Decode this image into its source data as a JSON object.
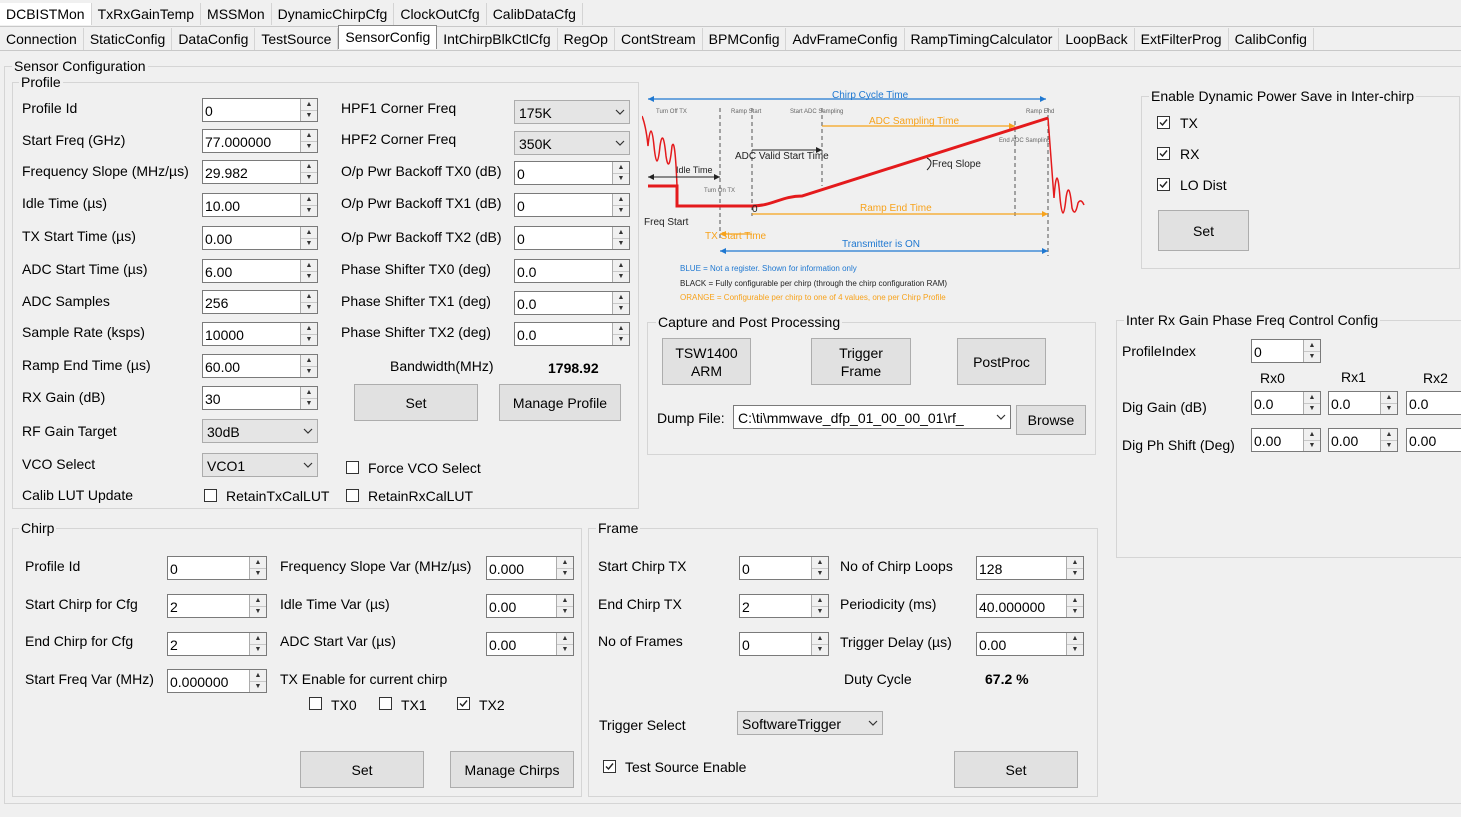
{
  "tabs_top": [
    "DCBISTMon",
    "TxRxGainTemp",
    "MSSMon",
    "DynamicChirpCfg",
    "ClockOutCfg",
    "CalibDataCfg"
  ],
  "tabs_second": [
    "Connection",
    "StaticConfig",
    "DataConfig",
    "TestSource",
    "SensorConfig",
    "IntChirpBlkCtlCfg",
    "RegOp",
    "ContStream",
    "BPMConfig",
    "AdvFrameConfig",
    "RampTimingCalculator",
    "LoopBack",
    "ExtFilterProg",
    "CalibConfig"
  ],
  "sensor_title": "Sensor Configuration",
  "profile": {
    "title": "Profile",
    "labels": {
      "profile_id": "Profile Id",
      "start_freq": "Start Freq (GHz)",
      "freq_slope": "Frequency Slope (MHz/µs)",
      "idle_time": "Idle Time (µs)",
      "tx_start": "TX Start Time (µs)",
      "adc_start": "ADC Start Time (µs)",
      "adc_samples": "ADC Samples",
      "sample_rate": "Sample Rate (ksps)",
      "ramp_end": "Ramp End Time (µs)",
      "rx_gain": "RX Gain (dB)",
      "rf_gain": "RF Gain Target",
      "vco": "VCO Select",
      "calib": "Calib LUT Update",
      "hpf1": "HPF1 Corner Freq",
      "hpf2": "HPF2 Corner Freq",
      "bo0": "O/p Pwr Backoff TX0 (dB)",
      "bo1": "O/p Pwr Backoff TX1 (dB)",
      "bo2": "O/p Pwr Backoff TX2 (dB)",
      "ps0": "Phase Shifter TX0 (deg)",
      "ps1": "Phase Shifter TX1 (deg)",
      "ps2": "Phase Shifter TX2 (deg)",
      "bandwidth": "Bandwidth(MHz)",
      "force_vco": "Force VCO Select",
      "retain_tx": "RetainTxCalLUT",
      "retain_rx": "RetainRxCalLUT"
    },
    "values": {
      "profile_id": "0",
      "start_freq": "77.000000",
      "freq_slope": "29.982",
      "idle_time": "10.00",
      "tx_start": "0.00",
      "adc_start": "6.00",
      "adc_samples": "256",
      "sample_rate": "10000",
      "ramp_end": "60.00",
      "rx_gain": "30",
      "rf_gain": "30dB",
      "vco": "VCO1",
      "hpf1": "175K",
      "hpf2": "350K",
      "bo0": "0",
      "bo1": "0",
      "bo2": "0",
      "ps0": "0.0",
      "ps1": "0.0",
      "ps2": "0.0",
      "bandwidth": "1798.92",
      "force_vco": false,
      "retain_tx": false,
      "retain_rx": false
    },
    "set_label": "Set",
    "manage_label": "Manage Profile"
  },
  "diagram": {
    "chirp_cycle": "Chirp Cycle Time",
    "turn_off_tx": "Turn Off TX",
    "ramp_start": "Ramp Start",
    "start_adc": "Start ADC Sampling",
    "adc_sampling_time": "ADC Sampling Time",
    "ramp_end": "Ramp End",
    "end_adc": "End ADC Sampling",
    "adc_valid": "ADC Valid Start Time",
    "idle_time": "Idle Time",
    "freq_slope": "Freq Slope",
    "turn_on_tx": "Turn On TX",
    "zero": "0",
    "ramp_end_time": "Ramp End Time",
    "freq_start": "Freq Start",
    "tx_start_time": "TX Start Time",
    "tx_on": "Transmitter is ON",
    "legend_blue": "BLUE = Not a register. Shown for information only",
    "legend_black": "BLACK = Fully configurable per chirp (through the chirp configuration RAM)",
    "legend_orange": "ORANGE = Configurable per chirp to one of 4 values, one per Chirp Profile"
  },
  "capture": {
    "title": "Capture and Post Processing",
    "tsw_label": "TSW1400 ARM",
    "trigger_label": "Trigger Frame",
    "postproc_label": "PostProc",
    "dump_label": "Dump File:",
    "dump_value": "C:\\ti\\mmwave_dfp_01_00_00_01\\rf_",
    "browse_label": "Browse"
  },
  "power_save": {
    "title": "Enable Dynamic Power Save in Inter-chirp",
    "tx_label": "TX",
    "tx": true,
    "rx_label": "RX",
    "rx": true,
    "lo_label": "LO Dist",
    "lo": true,
    "set_label": "Set"
  },
  "interrx": {
    "title": "Inter Rx Gain Phase Freq Control Config",
    "profile_index_label": "ProfileIndex",
    "profile_index": "0",
    "rx0": "Rx0",
    "rx1": "Rx1",
    "rx2": "Rx2",
    "dig_gain_label": "Dig Gain (dB)",
    "dig_ph_label": "Dig Ph Shift (Deg)",
    "gain": [
      "0.0",
      "0.0",
      "0.0"
    ],
    "phase": [
      "0.00",
      "0.00",
      "0.00"
    ]
  },
  "chirp": {
    "title": "Chirp",
    "labels": {
      "profile_id": "Profile Id",
      "start_chirp": "Start Chirp for Cfg",
      "end_chirp": "End Chirp for Cfg",
      "start_freq_var": "Start Freq Var (MHz)",
      "slope_var": "Frequency Slope Var (MHz/µs)",
      "idle_var": "Idle Time Var (µs)",
      "adc_var": "ADC Start Var (µs)",
      "tx_enable": "TX Enable for current chirp",
      "tx0": "TX0",
      "tx1": "TX1",
      "tx2": "TX2"
    },
    "values": {
      "profile_id": "0",
      "start_chirp": "2",
      "end_chirp": "2",
      "start_freq_var": "0.000000",
      "slope_var": "0.000",
      "idle_var": "0.00",
      "adc_var": "0.00",
      "tx0": false,
      "tx1": false,
      "tx2": true
    },
    "set_label": "Set",
    "manage_label": "Manage Chirps"
  },
  "frame": {
    "title": "Frame",
    "labels": {
      "start_tx": "Start Chirp TX",
      "end_tx": "End Chirp TX",
      "frames": "No of Frames",
      "loops": "No of Chirp Loops",
      "period": "Periodicity (ms)",
      "delay": "Trigger Delay (µs)",
      "duty": "Duty Cycle",
      "trigger": "Trigger Select",
      "test_source": "Test Source Enable"
    },
    "values": {
      "start_tx": "0",
      "end_tx": "2",
      "frames": "0",
      "loops": "128",
      "period": "40.000000",
      "delay": "0.00",
      "duty": "67.2 %",
      "trigger": "SoftwareTrigger",
      "test_source": true
    },
    "set_label": "Set"
  },
  "colors": {
    "blue": "#1f78d1",
    "orange": "#f7a21b",
    "red": "#e41a1c",
    "active_tab_bg": "#ffffff"
  }
}
